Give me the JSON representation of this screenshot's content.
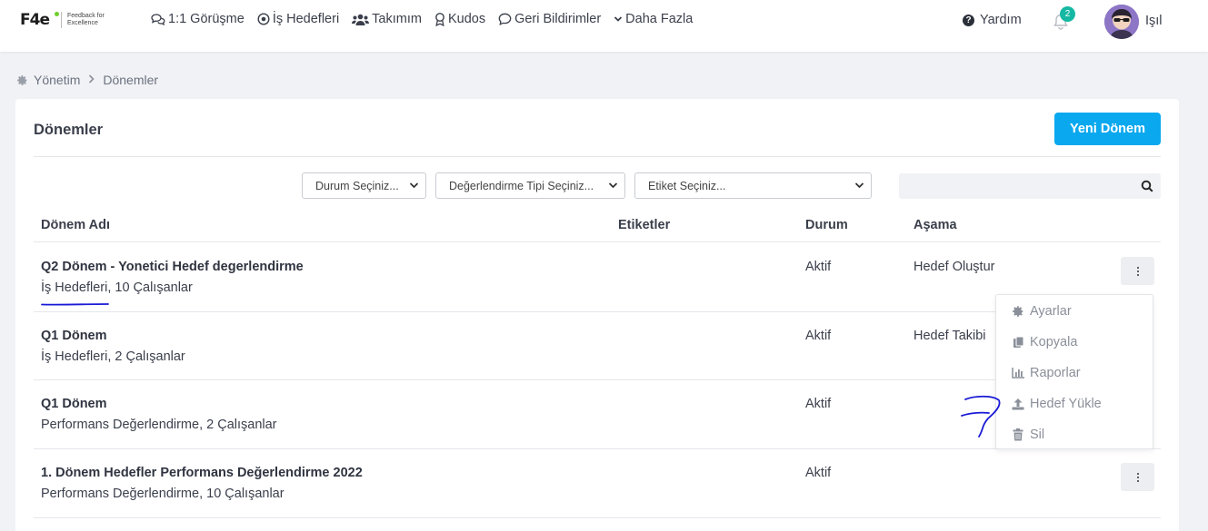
{
  "nav": {
    "logo_mark": "F4e",
    "logo_tagline_1": "Feedback for",
    "logo_tagline_2": "Excellence",
    "items": [
      {
        "label": "1:1 Görüşme",
        "icon": "chat-icon"
      },
      {
        "label": "İş Hedefleri",
        "icon": "target-icon"
      },
      {
        "label": "Takımım",
        "icon": "users-icon"
      },
      {
        "label": "Kudos",
        "icon": "award-icon"
      },
      {
        "label": "Geri Bildirimler",
        "icon": "comment-icon"
      },
      {
        "label": "Daha Fazla",
        "icon": "chevron-down-icon"
      }
    ],
    "help_label": "Yardım",
    "notification_count": "2",
    "user_name": "Işıl"
  },
  "breadcrumb": {
    "root": "Yönetim",
    "current": "Dönemler"
  },
  "page": {
    "title": "Dönemler",
    "new_button": "Yeni Dönem",
    "filters": {
      "status": "Durum Seçiniz...",
      "eval_type": "Değerlendirme Tipi Seçiniz...",
      "tag": "Etiket Seçiniz..."
    },
    "search_placeholder": ""
  },
  "table": {
    "headers": {
      "name": "Dönem Adı",
      "tags": "Etiketler",
      "status": "Durum",
      "stage": "Aşama"
    },
    "rows": [
      {
        "title": "Q2 Dönem - Yonetici Hedef degerlendirme",
        "subtitle": "İş Hedefleri, 10 Çalışanlar",
        "tags": "",
        "status": "Aktif",
        "stage": "Hedef Oluştur"
      },
      {
        "title": "Q1 Dönem",
        "subtitle": "İş Hedefleri, 2 Çalışanlar",
        "tags": "",
        "status": "Aktif",
        "stage": "Hedef Takibi"
      },
      {
        "title": "Q1 Dönem",
        "subtitle": "Performans Değerlendirme, 2 Çalışanlar",
        "tags": "",
        "status": "Aktif",
        "stage": ""
      },
      {
        "title": "1. Dönem Hedefler Performans Değerlendirme 2022",
        "subtitle": "Performans Değerlendirme, 10 Çalışanlar",
        "tags": "",
        "status": "Aktif",
        "stage": ""
      }
    ]
  },
  "menu": {
    "items": [
      {
        "label": "Ayarlar",
        "icon": "gear-icon"
      },
      {
        "label": "Kopyala",
        "icon": "copy-icon"
      },
      {
        "label": "Raporlar",
        "icon": "chart-icon"
      },
      {
        "label": "Hedef Yükle",
        "icon": "upload-icon"
      },
      {
        "label": "Sil",
        "icon": "trash-icon"
      }
    ]
  },
  "colors": {
    "primary": "#0aa8ef",
    "badge": "#16b8a3",
    "annotation": "#1a1ad6"
  }
}
